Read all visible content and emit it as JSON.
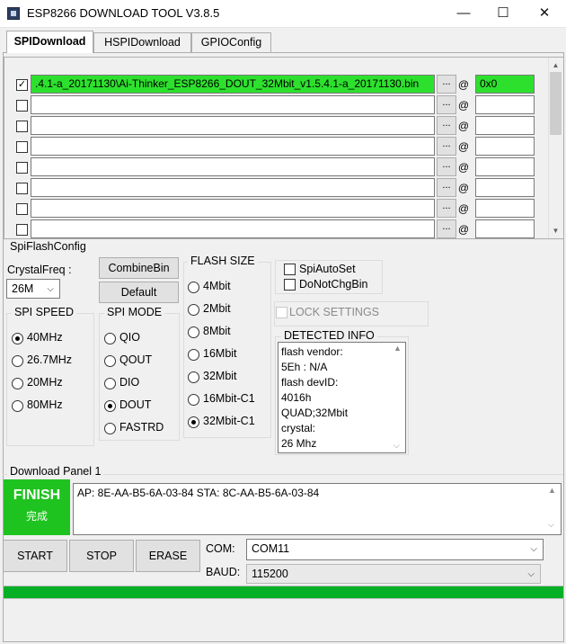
{
  "window": {
    "title": "ESP8266 DOWNLOAD TOOL V3.8.5",
    "minimize": "—",
    "maximize": "☐",
    "close": "✕"
  },
  "tabs": [
    {
      "label": "SPIDownload",
      "active": true
    },
    {
      "label": "HSPIDownload",
      "active": false
    },
    {
      "label": "GPIOConfig",
      "active": false
    }
  ],
  "files": [
    {
      "checked": true,
      "path": ".4.1-a_20171130\\Ai-Thinker_ESP8266_DOUT_32Mbit_v1.5.4.1-a_20171130.bin",
      "browse": "...",
      "at": "@",
      "address": "0x0"
    },
    {
      "checked": false,
      "path": "",
      "browse": "...",
      "at": "@",
      "address": ""
    },
    {
      "checked": false,
      "path": "",
      "browse": "...",
      "at": "@",
      "address": ""
    },
    {
      "checked": false,
      "path": "",
      "browse": "...",
      "at": "@",
      "address": ""
    },
    {
      "checked": false,
      "path": "",
      "browse": "...",
      "at": "@",
      "address": ""
    },
    {
      "checked": false,
      "path": "",
      "browse": "...",
      "at": "@",
      "address": ""
    },
    {
      "checked": false,
      "path": "",
      "browse": "...",
      "at": "@",
      "address": ""
    },
    {
      "checked": false,
      "path": "",
      "browse": "...",
      "at": "@",
      "address": ""
    }
  ],
  "spiflash": {
    "title": "SpiFlashConfig",
    "crystal_label": "CrystalFreq :",
    "crystal_value": "26M",
    "combine_bin": "CombineBin",
    "default": "Default",
    "spi_speed": {
      "title": "SPI SPEED",
      "options": [
        "40MHz",
        "26.7MHz",
        "20MHz",
        "80MHz"
      ],
      "selected": "40MHz"
    },
    "spi_mode": {
      "title": "SPI MODE",
      "options": [
        "QIO",
        "QOUT",
        "DIO",
        "DOUT",
        "FASTRD"
      ],
      "selected": "DOUT"
    },
    "flash_size": {
      "title": "FLASH SIZE",
      "options": [
        "4Mbit",
        "2Mbit",
        "8Mbit",
        "16Mbit",
        "32Mbit",
        "16Mbit-C1",
        "32Mbit-C1"
      ],
      "selected": "32Mbit-C1"
    },
    "spi_auto_set": "SpiAutoSet",
    "do_not_chg_bin": "DoNotChgBin",
    "lock_settings": "LOCK SETTINGS",
    "detected_info": {
      "title": "DETECTED INFO",
      "lines": [
        "flash vendor:",
        "5Eh : N/A",
        "flash devID:",
        "4016h",
        "QUAD;32Mbit",
        "crystal:",
        "26 Mhz"
      ]
    }
  },
  "download_panel": {
    "title": "Download Panel 1",
    "status": "FINISH",
    "status_sub": "完成",
    "status_color": "#1fc31f",
    "info": "AP:  8E-AA-B5-6A-03-84  STA:  8C-AA-B5-6A-03-84"
  },
  "controls": {
    "start": "START",
    "stop": "STOP",
    "erase": "ERASE",
    "com_label": "COM:",
    "com_value": "COM11",
    "baud_label": "BAUD:",
    "baud_value": "115200",
    "progress_percent": 100,
    "progress_color": "#06b025"
  }
}
